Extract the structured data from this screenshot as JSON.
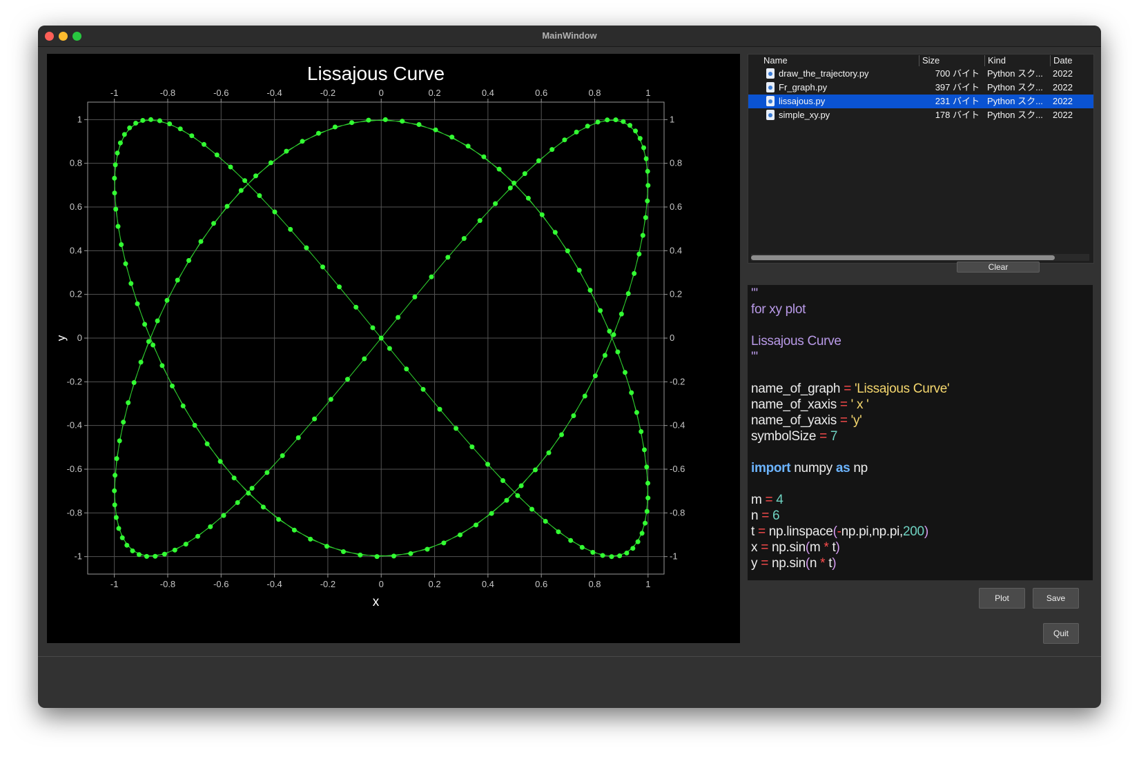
{
  "window": {
    "title": "MainWindow"
  },
  "chart_data": {
    "type": "scatter",
    "title": "Lissajous Curve",
    "xlabel": "x",
    "ylabel": "y",
    "xlim": [
      -1.1,
      1.06
    ],
    "ylim": [
      -1.08,
      1.08
    ],
    "xticks": [
      "-1",
      "-0.8",
      "-0.6",
      "-0.4",
      "-0.2",
      "0",
      "0.2",
      "0.4",
      "0.6",
      "0.8",
      "1"
    ],
    "yticks": [
      "-1",
      "-0.8",
      "-0.6",
      "-0.4",
      "-0.2",
      "0",
      "0.2",
      "0.4",
      "0.6",
      "0.8",
      "1"
    ],
    "grid": true,
    "equation": {
      "x": "sin(4t)",
      "y": "sin(6t)",
      "t_range": [
        -3.14159,
        3.14159
      ],
      "n_points": 200
    },
    "line_color": "#2ecc2e",
    "marker_color": "#33ff33"
  },
  "file_browser": {
    "columns": [
      "Name",
      "Size",
      "Kind",
      "Date"
    ],
    "rows": [
      {
        "name": "draw_the_trajectory.py",
        "size": "700 バイト",
        "kind": "Python スク...",
        "date": "2022"
      },
      {
        "name": "Fr_graph.py",
        "size": "397 バイト",
        "kind": "Python スク...",
        "date": "2022"
      },
      {
        "name": "lissajous.py",
        "size": "231 バイト",
        "kind": "Python スク...",
        "date": "2022",
        "selected": true
      },
      {
        "name": "simple_xy.py",
        "size": "178 バイト",
        "kind": "Python スク...",
        "date": "2022"
      }
    ]
  },
  "buttons": {
    "clear": "Clear",
    "plot": "Plot",
    "save": "Save",
    "quit": "Quit"
  },
  "code": {
    "lines": [
      [
        {
          "t": "'''",
          "c": "doc"
        }
      ],
      [
        {
          "t": "for xy plot",
          "c": "doc"
        }
      ],
      [],
      [
        {
          "t": "Lissajous Curve",
          "c": "doc"
        }
      ],
      [
        {
          "t": "'''",
          "c": "doc"
        }
      ],
      [],
      [
        {
          "t": "name_of_graph ",
          "c": "id"
        },
        {
          "t": "=",
          "c": "op"
        },
        {
          "t": " 'Lissajous Curve'",
          "c": "str"
        }
      ],
      [
        {
          "t": "name_of_xaxis ",
          "c": "id"
        },
        {
          "t": "=",
          "c": "op"
        },
        {
          "t": " ' x '",
          "c": "str"
        }
      ],
      [
        {
          "t": "name_of_yaxis ",
          "c": "id"
        },
        {
          "t": "=",
          "c": "op"
        },
        {
          "t": " 'y'",
          "c": "str"
        }
      ],
      [
        {
          "t": "symbolSize ",
          "c": "id"
        },
        {
          "t": "=",
          "c": "op"
        },
        {
          "t": " 7",
          "c": "num"
        }
      ],
      [],
      [
        {
          "t": "import",
          "c": "kw"
        },
        {
          "t": " numpy ",
          "c": "id"
        },
        {
          "t": "as",
          "c": "kw"
        },
        {
          "t": " np",
          "c": "id"
        }
      ],
      [],
      [
        {
          "t": "m ",
          "c": "id"
        },
        {
          "t": "=",
          "c": "op"
        },
        {
          "t": " 4",
          "c": "num"
        }
      ],
      [
        {
          "t": "n ",
          "c": "id"
        },
        {
          "t": "=",
          "c": "op"
        },
        {
          "t": " 6",
          "c": "num"
        }
      ],
      [
        {
          "t": "t ",
          "c": "id"
        },
        {
          "t": "=",
          "c": "op"
        },
        {
          "t": " np.linspace",
          "c": "id"
        },
        {
          "t": "(",
          "c": "par"
        },
        {
          "t": "-",
          "c": "op"
        },
        {
          "t": "np.pi,np.pi,",
          "c": "id"
        },
        {
          "t": "200",
          "c": "num"
        },
        {
          "t": ")",
          "c": "par"
        }
      ],
      [
        {
          "t": "x ",
          "c": "id"
        },
        {
          "t": "=",
          "c": "op"
        },
        {
          "t": " np.sin",
          "c": "id"
        },
        {
          "t": "(",
          "c": "par"
        },
        {
          "t": "m ",
          "c": "id"
        },
        {
          "t": "*",
          "c": "op"
        },
        {
          "t": " t",
          "c": "id"
        },
        {
          "t": ")",
          "c": "par"
        }
      ],
      [
        {
          "t": "y ",
          "c": "id"
        },
        {
          "t": "=",
          "c": "op"
        },
        {
          "t": " np.sin",
          "c": "id"
        },
        {
          "t": "(",
          "c": "par"
        },
        {
          "t": "n ",
          "c": "id"
        },
        {
          "t": "*",
          "c": "op"
        },
        {
          "t": " t",
          "c": "id"
        },
        {
          "t": ")",
          "c": "par"
        }
      ]
    ],
    "colors": {
      "doc": "#b99ae8",
      "id": "#ececec",
      "op": "#ff4d4d",
      "str": "#f5d76e",
      "num": "#6fd3c2",
      "kw": "#6cb4ff",
      "par": "#d49cf0"
    }
  }
}
